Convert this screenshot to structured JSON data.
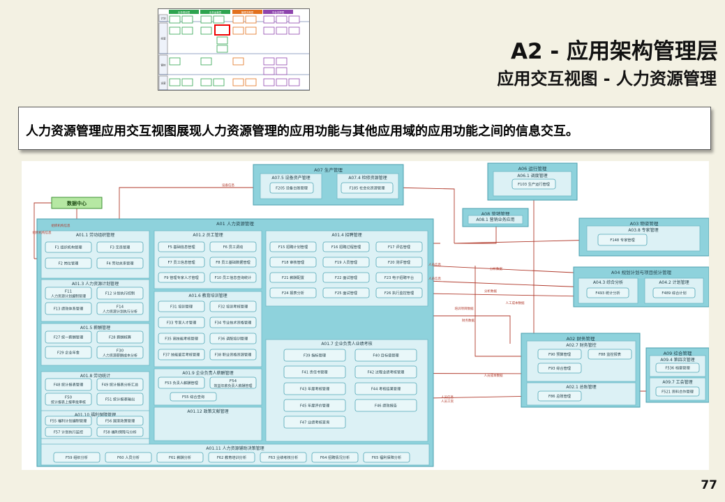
{
  "header": {
    "title": "A2 - 应用架构管理层",
    "subtitle": "应用交互视图 - 人力资源管理"
  },
  "description": "人力资源管理应用交互视图展现人力资源管理的应用功能与其他应用域的应用功能之间的信息交互。",
  "page_number": "77",
  "colors": {
    "background": "#f3f1e3",
    "module_fill": "#8ed2dc",
    "panel_fill": "#dcf1f5",
    "function_fill": "#e9f7f9",
    "data_center_fill": "#b6e8a3",
    "flow_line": "#b0392b"
  },
  "diagram": {
    "data_center": "数据中心",
    "main_module": "A01 人力资源管理",
    "groups": [
      {
        "title": "A01.1 劳动组织管理",
        "items": [
          "F1 组织机构管理",
          "F3 定员管理",
          "F2 岗位管理",
          "F4 劳动关系管理"
        ]
      },
      {
        "title": "A01.2 员工管理",
        "items": [
          "F5 基础信息管理",
          "F6 员工调动",
          "F7 员工信息管理",
          "F8 员工基础数据管理",
          "F9 管理专家人才管理",
          "F10 员工信息查询统计"
        ]
      },
      {
        "title": "A01.4 招聘管理",
        "items": [
          "F15 招聘计划管理",
          "F16 招聘过程管理",
          "F17 评估管理",
          "F18 审核管理",
          "F19 人员管理",
          "F20 测评管理",
          "F21 薪酬配置",
          "F22 面试管理",
          "F23 电子招聘平台",
          "F24 报表分析",
          "F25 面试管理",
          "F26 执行监控管理"
        ]
      },
      {
        "title": "A01.3 人力资源计划管理",
        "items": [
          "F11 人力资源计划编制管理",
          "F12 计划执行控制",
          "F13 绩效体系管理",
          "F14 人力资源计划执行分析"
        ]
      },
      {
        "title": "A01.6 教育培训管理",
        "items": [
          "F31 培训管理",
          "F32 培训考核管理",
          "F33 专家人才管理",
          "F34 专业技术资格管理",
          "F35 高技能考核管理",
          "F36 调配培训管理",
          "F37 技能鉴定考核管理",
          "F38 职业资格资源管理"
        ]
      },
      {
        "title": "A01.5 薪酬管理",
        "items": [
          "F27 统一薪酬管理",
          "F28 薪酬核算",
          "F29 企业年金",
          "F30 人力资源薪酬成本分析"
        ]
      },
      {
        "title": "A01.7 企业负责人业绩考核",
        "items": [
          "F39 指标管理",
          "F40 目标值管理",
          "F41 责任书管理",
          "F42 过程业绩考核管理",
          "F43 年度考核管理",
          "F44 考核结果管理",
          "F45 年度评价管理",
          "F46 绩效报告",
          "F47 业绩考核查询"
        ]
      },
      {
        "title": "A01.8 劳动统计",
        "items": [
          "F48 统计报表管理",
          "F49 统计报表分析汇总",
          "F50 统计报表上报审批审核",
          "F51 统计报表输出"
        ]
      },
      {
        "title": "A01.9 企业负责人薪酬管理",
        "items": [
          "F53 负责人薪酬管理",
          "F54 效益年薪负责人薪酬管理",
          "F55 综合查询"
        ]
      },
      {
        "title": "A01.10 福利保障管理",
        "items": [
          "F55 福利计划编制管理",
          "F56 国家政策管理",
          "F57 计划执行监控",
          "F58 福利保障与分析"
        ]
      },
      {
        "title": "A01.12 政策文献管理",
        "items": []
      },
      {
        "title": "A01.11 人力资源辅助决策管理",
        "items": [
          "F59 组织分析",
          "F60 人员分析",
          "F61 薪酬分析",
          "F62 教育培训分析",
          "F63 业绩考核分析",
          "F64 招聘情况分析",
          "F65 福利保障分析"
        ]
      }
    ],
    "external": [
      {
        "title": "A07 生产管理",
        "subs": [
          {
            "title": "A07.5 设备资产管理",
            "item": "F205 设备台账管理"
          },
          {
            "title": "A07.4 检修资源管理",
            "item": "F185 社会化资源管理"
          }
        ]
      },
      {
        "title": "A06 运行管理",
        "subs": [
          {
            "title": "A06.1 调度管理",
            "item": "F103 生产运行管理"
          }
        ]
      },
      {
        "title": "A08 营销管理",
        "subs": [
          {
            "title": "A08.1 营销业务应用",
            "item": ""
          }
        ]
      },
      {
        "title": "A03 物资管理",
        "subs": [
          {
            "title": "A03.8 专家管理",
            "item": "F148 专家管理"
          }
        ]
      },
      {
        "title": "A04 规划计划与项目统计管理",
        "subs": [
          {
            "title": "A04.3 综合分析",
            "item": "F493 统计分析"
          },
          {
            "title": "A04.2 计划管理",
            "item": "F489 综合计划"
          }
        ]
      },
      {
        "title": "A02 财务管理",
        "subs": [
          {
            "title": "A02.7 财务管控",
            "items": [
              "F90 预算管理",
              "F88 监控报表",
              "F93 综合管理"
            ]
          },
          {
            "title": "A02.1 总账管理",
            "items": [
              "F86 总账管理"
            ]
          }
        ]
      },
      {
        "title": "A09 综合管理",
        "subs": [
          {
            "title": "A09.4 第四次管理",
            "item": "F536 档案管理"
          },
          {
            "title": "A09.7 工会管理",
            "item": "F521 资料合作管理"
          }
        ]
      }
    ],
    "flow_labels": [
      "设备信息",
      "组织机构信息",
      "组织机构信息",
      "人员信息",
      "人员信息",
      "分析数据",
      "分析数据",
      "人工成本数据",
      "培训项目数据",
      "财务数据",
      "人员成本数据",
      "人员信息",
      "人员工资"
    ]
  },
  "thumbnail": {
    "columns": [
      "业务规划层",
      "业务运营层",
      "管理决策层",
      "平台支撑层"
    ],
    "rows": [
      "计划",
      "经营",
      "管控",
      "运营"
    ]
  }
}
